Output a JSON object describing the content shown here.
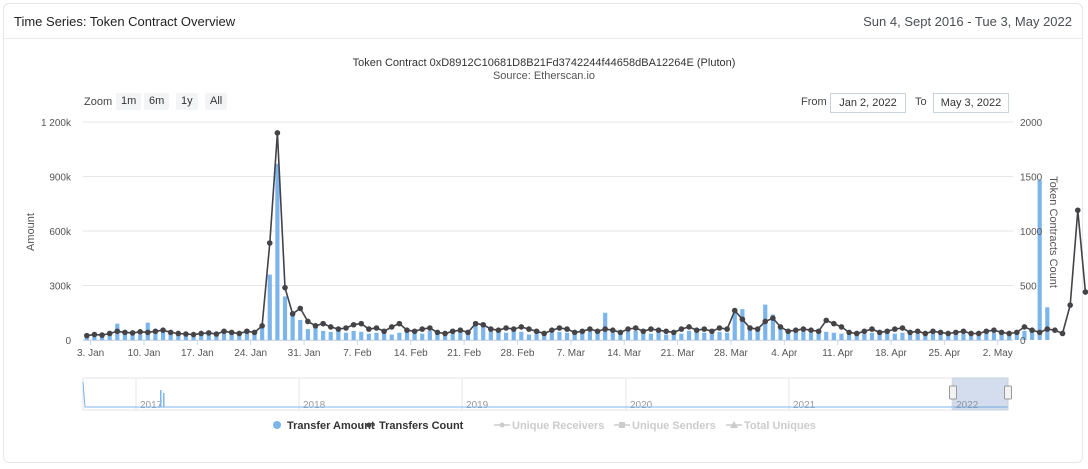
{
  "header": {
    "title": "Time Series: Token Contract Overview",
    "date_range": "Sun 4, Sept 2016 - Tue 3, May 2022"
  },
  "chart_title": "Token Contract 0xD8912C10681D8B21Fd3742244f44658dBA12264E (Pluton)",
  "chart_subtitle": "Source: Etherscan.io",
  "zoom": {
    "label": "Zoom",
    "buttons": [
      "1m",
      "6m",
      "1y",
      "All"
    ]
  },
  "range": {
    "from_label": "From",
    "from_value": "Jan 2, 2022",
    "to_label": "To",
    "to_value": "May 3, 2022"
  },
  "colors": {
    "bars": "#7cb5ec",
    "line": "#434348",
    "disabled": "#cccccc",
    "grid": "#e6e6e6"
  },
  "navigator": {
    "years": [
      "2017",
      "2018",
      "2019",
      "2020",
      "2021",
      "2022"
    ]
  },
  "chart_data": {
    "type": "bar+line",
    "x_start": "2022-01-02",
    "x_end": "2022-05-03",
    "x_ticks": [
      "3. Jan",
      "10. Jan",
      "17. Jan",
      "24. Jan",
      "31. Jan",
      "7. Feb",
      "14. Feb",
      "21. Feb",
      "28. Feb",
      "7. Mar",
      "14. Mar",
      "21. Mar",
      "28. Mar",
      "4. Apr",
      "11. Apr",
      "18. Apr",
      "25. Apr",
      "2. May"
    ],
    "y_left": {
      "label": "Amount",
      "ticks": [
        "0",
        "300k",
        "600k",
        "900k",
        "1 200k"
      ],
      "range": [
        0,
        1200000
      ]
    },
    "y_right": {
      "label": "Token Contracts Count",
      "ticks": [
        "0",
        "500",
        "1000",
        "1500",
        "2000"
      ],
      "range": [
        0,
        2000
      ]
    },
    "series": [
      {
        "name": "Transfer Amount",
        "type": "bar",
        "values": [
          20000,
          30000,
          25000,
          40000,
          90000,
          35000,
          45000,
          30000,
          95000,
          40000,
          60000,
          35000,
          40000,
          30000,
          25000,
          45000,
          35000,
          25000,
          50000,
          45000,
          30000,
          60000,
          40000,
          70000,
          360000,
          970000,
          240000,
          150000,
          110000,
          60000,
          80000,
          50000,
          45000,
          55000,
          40000,
          50000,
          45000,
          35000,
          40000,
          50000,
          30000,
          40000,
          60000,
          45000,
          35000,
          50000,
          40000,
          30000,
          35000,
          45000,
          40000,
          90000,
          80000,
          50000,
          45000,
          40000,
          50000,
          45000,
          30000,
          40000,
          35000,
          40000,
          45000,
          40000,
          30000,
          50000,
          45000,
          40000,
          150000,
          40000,
          35000,
          45000,
          50000,
          40000,
          35000,
          45000,
          30000,
          40000,
          35000,
          50000,
          45000,
          40000,
          35000,
          45000,
          40000,
          170000,
          170000,
          80000,
          60000,
          195000,
          140000,
          60000,
          50000,
          45000,
          55000,
          40000,
          50000,
          45000,
          40000,
          35000,
          30000,
          40000,
          35000,
          40000,
          50000,
          45000,
          35000,
          40000,
          30000,
          35000,
          40000,
          45000,
          35000,
          40000,
          30000,
          35000,
          40000,
          45000,
          35000,
          40000,
          30000,
          35000,
          40000,
          50000,
          60000,
          880000,
          180000
        ],
        "color": "#7cb5ec"
      },
      {
        "name": "Transfers Count",
        "type": "line",
        "values": [
          40,
          50,
          45,
          60,
          80,
          70,
          65,
          75,
          70,
          80,
          90,
          70,
          60,
          55,
          50,
          60,
          65,
          55,
          80,
          70,
          60,
          80,
          70,
          130,
          890,
          1900,
          480,
          240,
          290,
          170,
          130,
          150,
          120,
          100,
          110,
          140,
          150,
          100,
          110,
          80,
          120,
          150,
          90,
          80,
          100,
          110,
          70,
          60,
          80,
          90,
          70,
          150,
          140,
          100,
          90,
          110,
          100,
          120,
          100,
          80,
          60,
          90,
          110,
          100,
          70,
          80,
          100,
          80,
          100,
          90,
          70,
          100,
          110,
          80,
          100,
          90,
          80,
          70,
          100,
          120,
          90,
          100,
          80,
          110,
          100,
          270,
          190,
          110,
          100,
          170,
          200,
          120,
          80,
          90,
          100,
          90,
          80,
          180,
          150,
          120,
          70,
          60,
          80,
          100,
          70,
          80,
          100,
          110,
          70,
          80,
          60,
          80,
          70,
          60,
          70,
          80,
          60,
          60,
          80,
          90,
          70,
          60,
          70,
          120,
          90,
          70,
          100,
          90,
          60,
          320,
          1190,
          440
        ],
        "color": "#434348"
      }
    ],
    "legend": [
      {
        "name": "Transfer Amount",
        "enabled": true
      },
      {
        "name": "Transfers Count",
        "enabled": true
      },
      {
        "name": "Unique Receivers",
        "enabled": false
      },
      {
        "name": "Unique Senders",
        "enabled": false
      },
      {
        "name": "Total Uniques",
        "enabled": false
      }
    ],
    "legend_position": "bottom-center",
    "grid": true
  }
}
